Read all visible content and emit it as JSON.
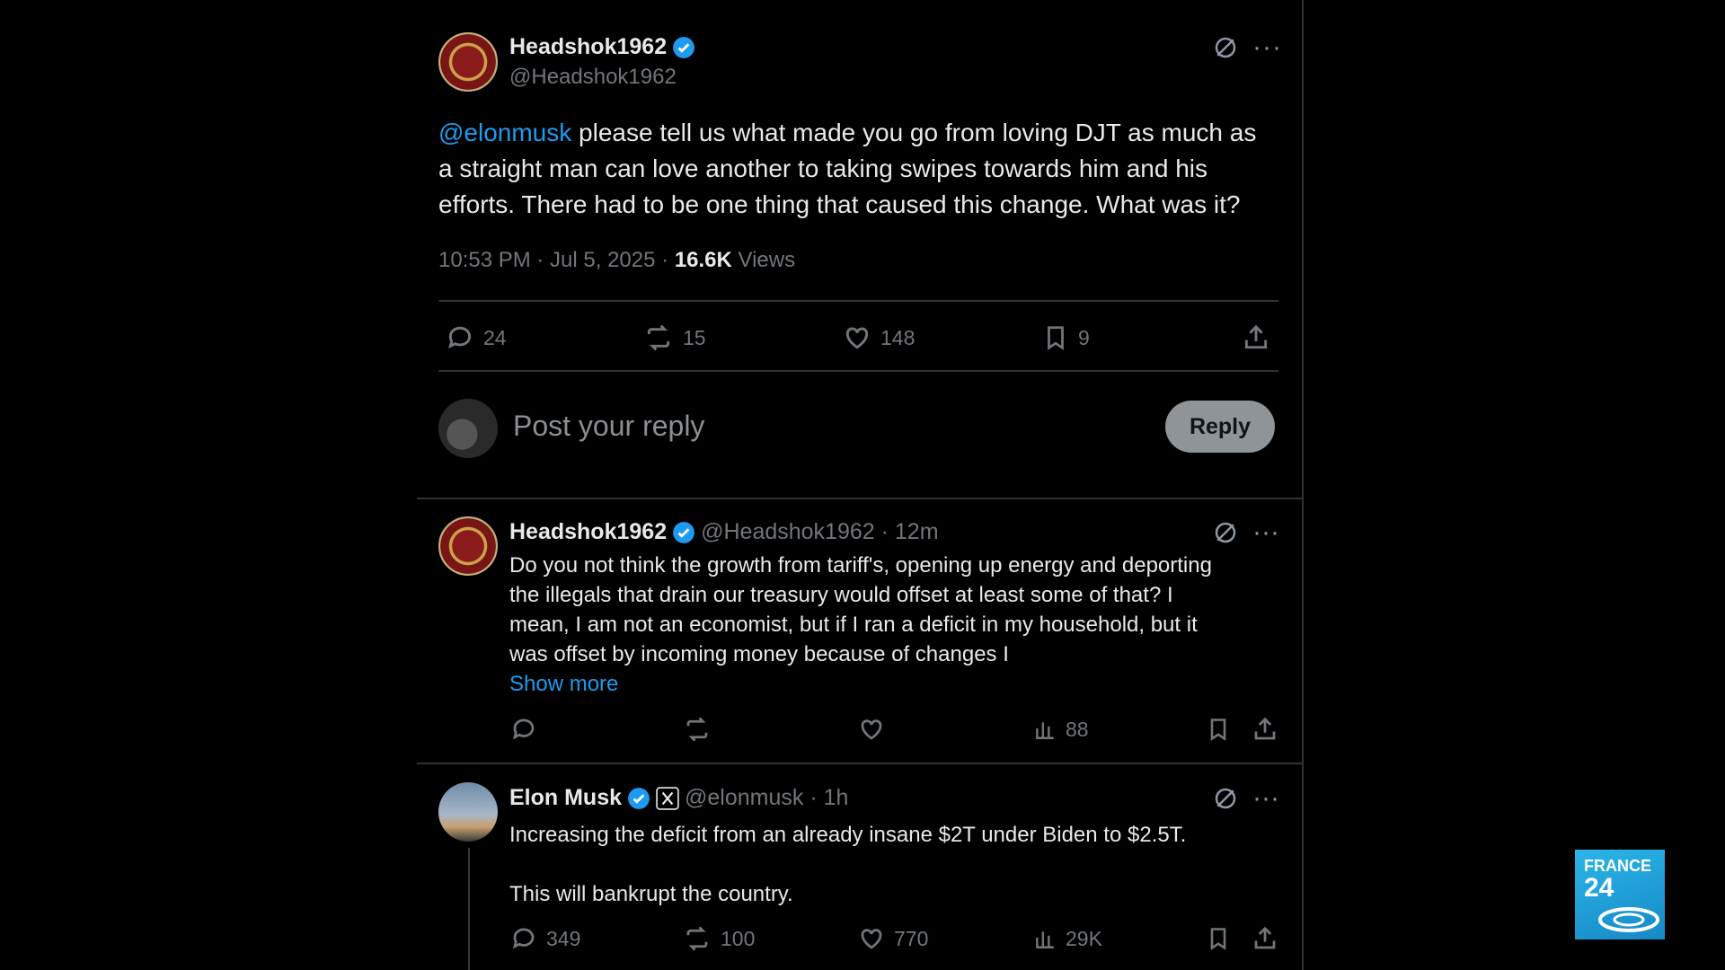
{
  "main_post": {
    "display_name": "Headshok1962",
    "handle": "@Headshok1962",
    "mention": "@elonmusk",
    "text_line1": " please tell us what made you go from loving DJT as much as",
    "text_line2": "a straight man can love another to taking swipes towards him and his",
    "text_line3": "efforts.  There had to be one thing that caused this change.  What was it?",
    "timestamp": "10:53 PM · Jul 5, 2025 · ",
    "views_count": "16.6K",
    "views_label": " Views",
    "replies": "24",
    "reposts": "15",
    "likes": "148",
    "bookmarks": "9"
  },
  "reply_composer": {
    "placeholder": "Post your reply",
    "button_label": "Reply"
  },
  "reply1": {
    "display_name": "Headshok1962",
    "handle_time": "@Headshok1962 · 12m",
    "line1": "Do you not think the growth from tariff's, opening up energy and deporting",
    "line2": "the illegals that drain our treasury would offset at least some of that?  I",
    "line3": "mean, I am not an economist, but if I ran a deficit in my household, but it",
    "line4": "was offset by incoming money because of changes I",
    "show_more": "Show more",
    "views": "88"
  },
  "reply2": {
    "display_name": "Elon Musk",
    "handle_time": "@elonmusk · 1h",
    "line1": "Increasing the deficit from an already insane $2T under Biden to $2.5T.",
    "line2": "This will bankrupt the country.",
    "replies": "349",
    "reposts": "100",
    "likes": "770",
    "views": "29K"
  },
  "broadcaster_logo": {
    "line1": "FRANCE",
    "line2": "24"
  },
  "colors": {
    "background": "#000000",
    "accent": "#1d9bf0",
    "muted": "#71767b"
  }
}
